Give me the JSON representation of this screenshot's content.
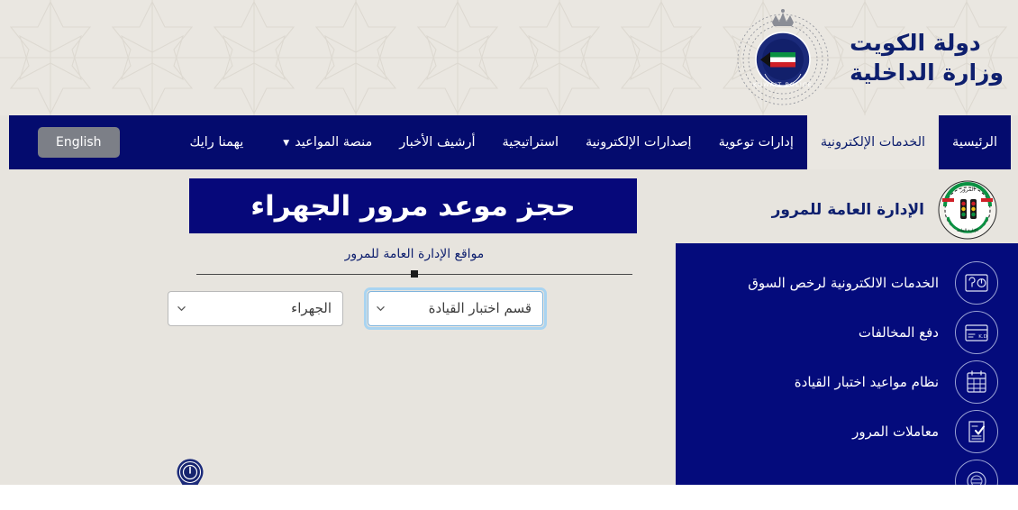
{
  "header": {
    "country_line": "دولة الكويت",
    "ministry_line": "وزارة الداخلية",
    "emblem_name": "kuwait-police-emblem",
    "emblem_ring_text": "KUWAIT POLICE"
  },
  "nav": {
    "items": [
      {
        "label": "الرئيسية",
        "active": false,
        "has_caret": false
      },
      {
        "label": "الخدمات الإلكترونية",
        "active": true,
        "has_caret": false
      },
      {
        "label": "إدارات توعوية",
        "active": false,
        "has_caret": false
      },
      {
        "label": "إصدارات الإلكترونية",
        "active": false,
        "has_caret": false
      },
      {
        "label": "استراتيجية",
        "active": false,
        "has_caret": false
      },
      {
        "label": "أرشيف الأخبار",
        "active": false,
        "has_caret": false
      },
      {
        "label": "منصة المواعيد",
        "active": false,
        "has_caret": true
      },
      {
        "label": "يهمنا رايك",
        "active": false,
        "has_caret": false
      }
    ],
    "language_button": "English",
    "caret_glyph": "▼"
  },
  "booking": {
    "page_title": "حجز موعد مرور الجهراء",
    "locations_caption": "مواقع الإدارة العامة للمرور",
    "governorate_select": {
      "value": "الجهراء",
      "options": [
        "الجهراء"
      ],
      "focused": false
    },
    "department_select": {
      "value": "قسم اختبار القيادة",
      "options": [
        "قسم اختبار القيادة"
      ],
      "focused": true
    },
    "map_pin_name": "map-location-pin"
  },
  "sidebar": {
    "department_title": "الإدارة العامة للمرور",
    "department_emblem_name": "general-traffic-department-emblem",
    "services": [
      {
        "label": "الخدمات الالكترونية لرخص السوق",
        "icon": "license-card-icon"
      },
      {
        "label": "دفع المخالفات",
        "icon": "payment-card-kd-icon"
      },
      {
        "label": "نظام مواعيد اختبار القيادة",
        "icon": "calendar-icon"
      },
      {
        "label": "معاملات المرور",
        "icon": "document-check-icon"
      },
      {
        "label": "",
        "icon": "traffic-emblem-icon"
      }
    ]
  },
  "colors": {
    "navy": "#040b6e",
    "panel_navy": "#040b7c",
    "beige": "#e7e4de",
    "header_beige": "#eae7e1",
    "brand_blue": "#0e1f6e",
    "focus_ring": "#a9d4f1",
    "lang_button_gray": "#7c7f87"
  }
}
